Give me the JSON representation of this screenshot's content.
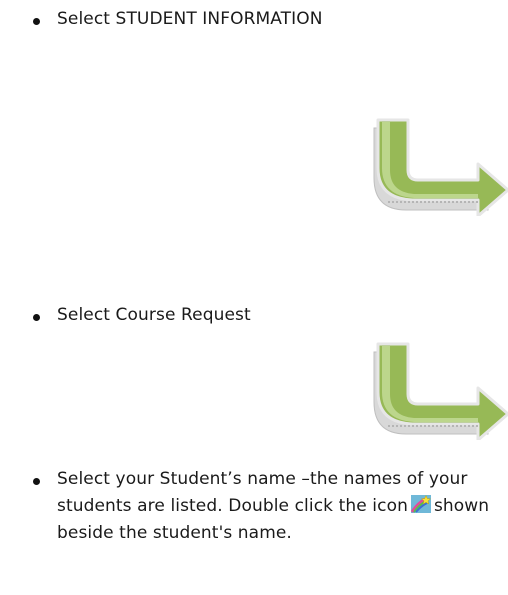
{
  "steps": [
    {
      "text": "Select STUDENT INFORMATION"
    },
    {
      "text": "Select Course Request"
    },
    {
      "text_before_icon": "Select your Student’s name –the names of your students are listed.  Double click the icon",
      "icon": "shooting-star-icon",
      "text_after_icon": "shown beside the student's name."
    }
  ],
  "colors": {
    "arrow_fill": "#97b956",
    "arrow_light": "#c6dd9a",
    "arrow_side": "#d9d9d9",
    "icon_bg": "#6fb8d8",
    "icon_star": "#f7e23a"
  }
}
